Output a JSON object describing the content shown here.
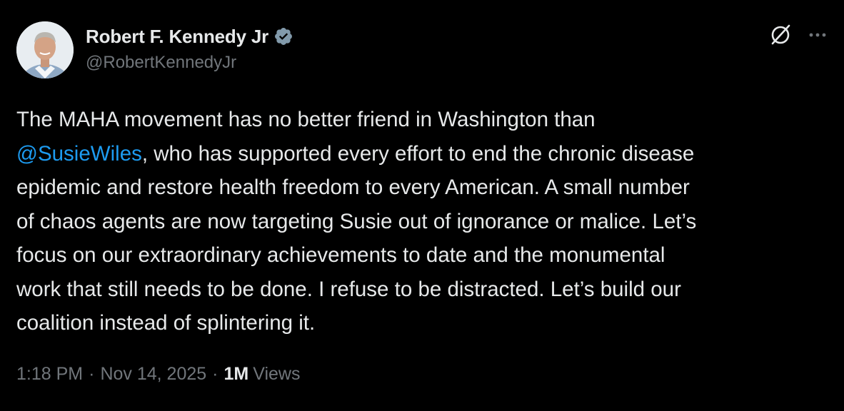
{
  "author": {
    "display_name": "Robert F. Kennedy Jr",
    "handle": "@RobertKennedyJr",
    "verified_badge_color": "#829aab"
  },
  "tweet": {
    "lines": [
      {
        "before": "The MAHA movement has no better friend in Washington than",
        "mention": "",
        "after": ""
      },
      {
        "before": "",
        "mention": "@SusieWiles",
        "after": ", who has supported every effort to end the chronic disease"
      },
      {
        "before": "epidemic and restore health freedom to every American. A small number",
        "mention": "",
        "after": ""
      },
      {
        "before": "of chaos agents are now targeting Susie out of ignorance or malice. Let’s",
        "mention": "",
        "after": ""
      },
      {
        "before": "focus on our extraordinary achievements to date and the monumental",
        "mention": "",
        "after": ""
      },
      {
        "before": "work that still needs to be done. I refuse to be distracted. Let’s build our",
        "mention": "",
        "after": ""
      },
      {
        "before": "coalition instead of splintering it.",
        "mention": "",
        "after": ""
      }
    ]
  },
  "meta": {
    "time": "1:18 PM",
    "separator": "·",
    "date": "Nov 14, 2025",
    "views_count": "1M",
    "views_label": "Views"
  },
  "icons": {
    "grok": "grok-icon",
    "more": "more-horizontal-icon",
    "verified": "verified-badge-icon"
  },
  "colors": {
    "background": "#000000",
    "text": "#e7e9ea",
    "secondary": "#71767b",
    "link": "#1d9bf0"
  }
}
